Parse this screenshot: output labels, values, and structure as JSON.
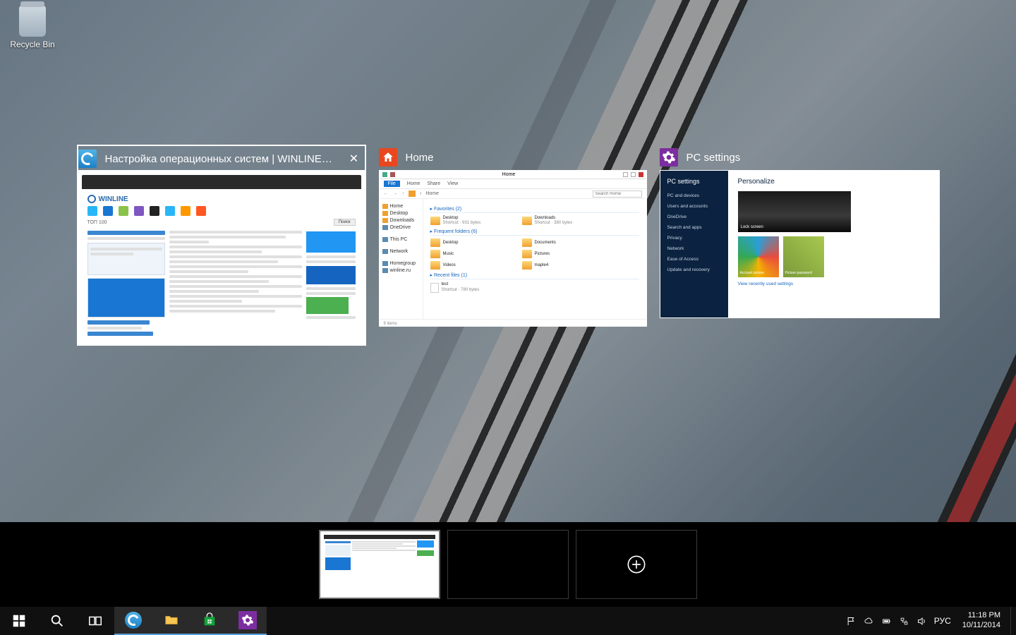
{
  "desktop": {
    "recycle_bin": "Recycle Bin"
  },
  "task_cards": [
    {
      "icon": "ie",
      "title": "Настройка операционных систем | WINLINE.RU ...",
      "close": "✕"
    },
    {
      "icon": "home",
      "title": "Home"
    },
    {
      "icon": "gear",
      "title": "PC settings"
    }
  ],
  "ie_thumb": {
    "logo": "WINLINE",
    "apps": [
      {
        "c": "#29b6f6"
      },
      {
        "c": "#1976d2"
      },
      {
        "c": "#8bc34a"
      },
      {
        "c": "#7e57c2"
      },
      {
        "c": "#222"
      },
      {
        "c": "#29b6f6"
      },
      {
        "c": "#ff9800"
      },
      {
        "c": "#ff5722"
      }
    ],
    "top_label": "ТОП 100",
    "btn": "Поиск"
  },
  "explorer": {
    "ribbons": [
      "File",
      "Home",
      "Share",
      "View"
    ],
    "title": "Home",
    "path": [
      "Home"
    ],
    "search_ph": "Search Home",
    "side": [
      {
        "icon": "fo",
        "label": "Home"
      },
      {
        "icon": "fo",
        "label": "Desktop"
      },
      {
        "icon": "fo",
        "label": "Downloads"
      },
      {
        "icon": "pc",
        "label": "OneDrive"
      },
      {
        "icon": "pc",
        "label": "This PC"
      },
      {
        "icon": "pc",
        "label": "Network"
      },
      {
        "icon": "pc",
        "label": "Homegroup"
      },
      {
        "icon": "pc",
        "label": "winline.ru"
      }
    ],
    "sections": [
      {
        "title": "Favorites (2)",
        "items": [
          {
            "name": "Desktop",
            "meta": "Shortcut · 931 bytes",
            "icon": "fo"
          },
          {
            "name": "Downloads",
            "meta": "Shortcut · 380 bytes",
            "icon": "fo"
          }
        ]
      },
      {
        "title": "Frequent folders (6)",
        "items": [
          {
            "name": "Desktop",
            "meta": "",
            "icon": "fo"
          },
          {
            "name": "Documents",
            "meta": "",
            "icon": "fo"
          },
          {
            "name": "Music",
            "meta": "",
            "icon": "fo"
          },
          {
            "name": "Pictures",
            "meta": "",
            "icon": "fo"
          },
          {
            "name": "Videos",
            "meta": "",
            "icon": "fo"
          },
          {
            "name": "maple4",
            "meta": "",
            "icon": "fo"
          }
        ]
      },
      {
        "title": "Recent files (1)",
        "items": [
          {
            "name": "test",
            "meta": "Shortcut · 780 bytes",
            "icon": "fi"
          }
        ]
      }
    ],
    "status": "9 items"
  },
  "settings": {
    "header": "PC settings",
    "side": [
      "PC and devices",
      "Users and accounts",
      "OneDrive",
      "Search and apps",
      "Privacy",
      "Network",
      "Ease of Access",
      "Update and recovery"
    ],
    "section": "Personalize",
    "lock": "Lock screen",
    "acc": "Account picture",
    "pic": "Picture password",
    "footer": "View recently used settings"
  },
  "virtual_desktops": {
    "count": 3,
    "add_label": "New desktop"
  },
  "taskbar": {
    "buttons": [
      "start",
      "search",
      "taskview",
      "ie",
      "explorer",
      "store",
      "settings"
    ]
  },
  "tray": {
    "lang": "РУС",
    "time": "11:18 PM",
    "date": "10/11/2014"
  }
}
